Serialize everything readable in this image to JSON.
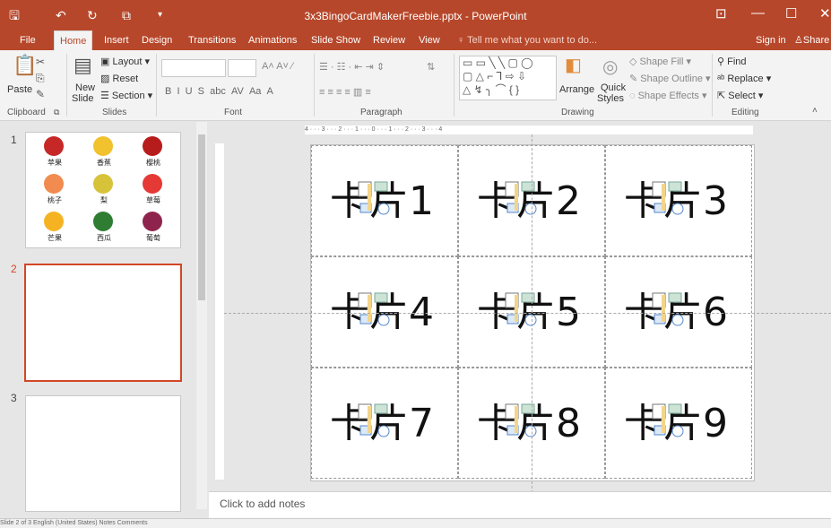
{
  "window": {
    "title": "3x3BingoCardMakerFreebie.pptx - PowerPoint",
    "icons": [
      "save-icon",
      "undo-icon",
      "redo-icon",
      "presenter-icon",
      "customize-icon"
    ]
  },
  "tabs": [
    {
      "label": "File"
    },
    {
      "label": "Home"
    },
    {
      "label": "Insert"
    },
    {
      "label": "Design"
    },
    {
      "label": "Transitions"
    },
    {
      "label": "Animations"
    },
    {
      "label": "Slide Show"
    },
    {
      "label": "Review"
    },
    {
      "label": "View"
    }
  ],
  "tellme": "Tell me what you want to do...",
  "signin": "Sign in",
  "share": "Share",
  "ribbon": {
    "clipboard": {
      "label": "Clipboard",
      "paste": "Paste"
    },
    "slides": {
      "label": "Slides",
      "new_slide": "New",
      "new_slide2": "Slide",
      "layout": "Layout",
      "reset": "Reset",
      "section": "Section"
    },
    "font": {
      "label": "Font"
    },
    "paragraph": {
      "label": "Paragraph"
    },
    "drawing": {
      "label": "Drawing",
      "arrange": "Arrange",
      "quick": "Quick",
      "styles": "Styles",
      "shape_fill": "Shape Fill",
      "shape_outline": "Shape Outline",
      "shape_effects": "Shape Effects"
    },
    "editing": {
      "label": "Editing",
      "find": "Find",
      "replace": "Replace",
      "select": "Select"
    }
  },
  "thumbnails": [
    {
      "number": "1"
    },
    {
      "number": "2"
    },
    {
      "number": "3"
    }
  ],
  "fruits": [
    {
      "name": "苹果",
      "color": "#c62828"
    },
    {
      "name": "香蕉",
      "color": "#f2c12e"
    },
    {
      "name": "樱桃",
      "color": "#b71c1c"
    },
    {
      "name": "桃子",
      "color": "#f28b50"
    },
    {
      "name": "梨",
      "color": "#d7c33a"
    },
    {
      "name": "草莓",
      "color": "#e53935"
    },
    {
      "name": "芒果",
      "color": "#f5b323"
    },
    {
      "name": "西瓜",
      "color": "#2e7d32"
    },
    {
      "name": "葡萄",
      "color": "#8e244d"
    }
  ],
  "cards": [
    {
      "text": "卡片1"
    },
    {
      "text": "卡片2"
    },
    {
      "text": "卡片3"
    },
    {
      "text": "卡片4"
    },
    {
      "text": "卡片5"
    },
    {
      "text": "卡片6"
    },
    {
      "text": "卡片7"
    },
    {
      "text": "卡片8"
    },
    {
      "text": "卡片9"
    }
  ],
  "notes": "Click to add notes",
  "ruler_text": "4 · · · 3 · · · 2 · · · 1 · · · 0 · · · 1 · · · 2 · · · 3 · · · 4",
  "status": "Slide 2 of 3    English (United States)    Notes    Comments"
}
